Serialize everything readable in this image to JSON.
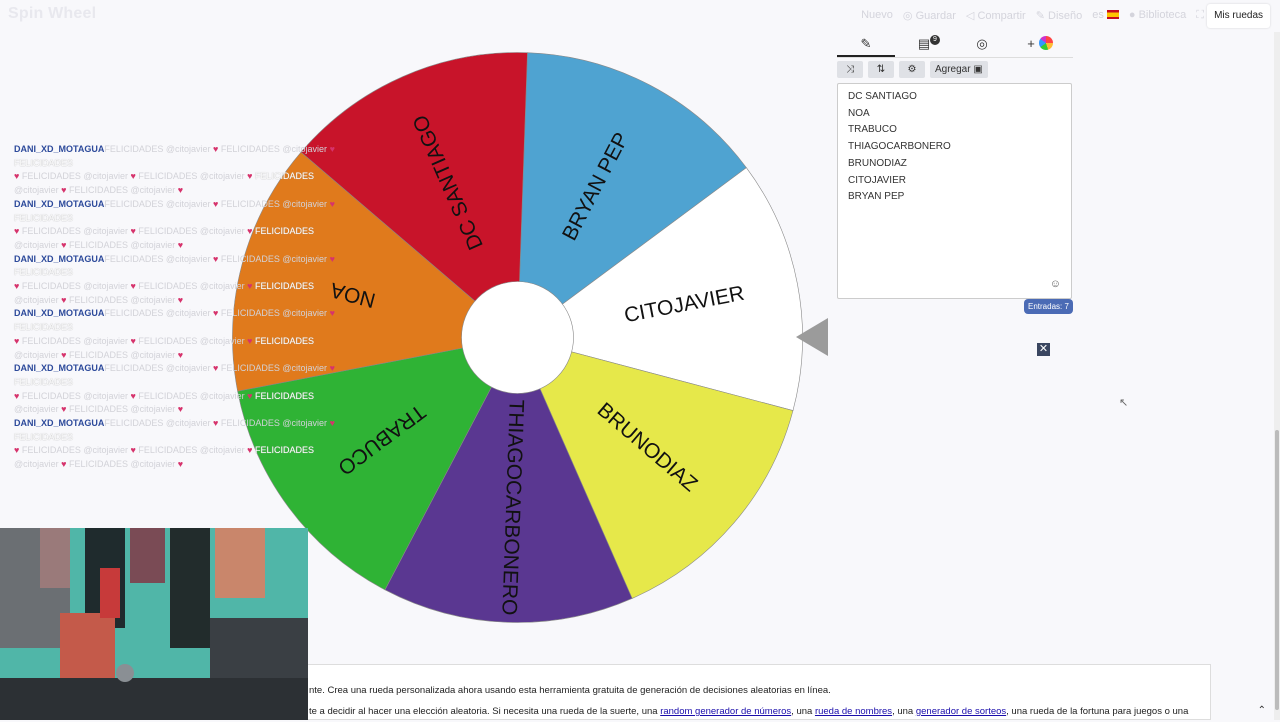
{
  "app": {
    "logo": "Spin Wheel"
  },
  "nav": {
    "nuevo": "Nuevo",
    "guardar": "Guardar",
    "compartir": "Compartir",
    "diseno": "Diseño",
    "lang": "es",
    "biblioteca": "Biblioteca",
    "mis_ruedas": "Mis ruedas"
  },
  "wheel": {
    "segments": [
      {
        "label": "BRYAN PEP",
        "color": "#4fa3d1"
      },
      {
        "label": "CITOJAVIER",
        "color": "#ffffff"
      },
      {
        "label": "BRUNODIAZ",
        "color": "#e6e84a"
      },
      {
        "label": "THIAGOCARBONERO",
        "color": "#5a3791"
      },
      {
        "label": "TRABUCO",
        "color": "#2fb335"
      },
      {
        "label": "NOA",
        "color": "#e07a1c"
      },
      {
        "label": "DC SANTIAGO",
        "color": "#c8142a"
      }
    ]
  },
  "chat": {
    "user": "DANI_XD_MOTAGUA",
    "line1": ": FELICIDADES @citojavier",
    "line2": "FELICIDADES @citojavier",
    "line2b": "FELICIDADES @citojavier",
    "highlight": "FELICIDADES @citojavier",
    "highlight2": "FELICIDADES",
    "line3": "@citojavier",
    "line3b": "FELICIDADES @citojavier",
    "top_line": "FELICIDADES @citojavier",
    "top_line2": "FELICIDADES @citojavier",
    "top_hl": "FELICIDADES",
    "top_line3": "@citojavier",
    "top_line3b": "FELICIDADES @citojavier"
  },
  "panel": {
    "badge": "9",
    "add_button": "Agregar",
    "entries": [
      "DC SANTIAGO",
      "NOA",
      "TRABUCO",
      "THIAGOCARBONERO",
      "BRUNODIAZ",
      "CITOJAVIER",
      "BRYAN PEP"
    ],
    "count_label": "Entradas: 7"
  },
  "info": {
    "line1": "nte. Crea una rueda personalizada ahora usando esta herramienta gratuita de generación de decisiones aleatorias en línea.",
    "line2_pre": "te a decidir al hacer una elección aleatoria. Si necesita una rueda de la suerte, una",
    "link1": "random generador de números",
    "sep1": ", una",
    "link2": "rueda de nombres",
    "sep2": ", una",
    "link3": "generador de sorteos",
    "line2_post": ", una rueda de la fortuna para juegos o una"
  },
  "icons": {
    "pencil": "pencil-icon",
    "clipboard": "clipboard-icon",
    "hide": "eye-slash-icon",
    "shuffle": "shuffle-icon",
    "sort": "sort-icon",
    "settings": "gear-icon",
    "image": "image-icon",
    "smile": "smile-icon",
    "close": "close-icon"
  }
}
